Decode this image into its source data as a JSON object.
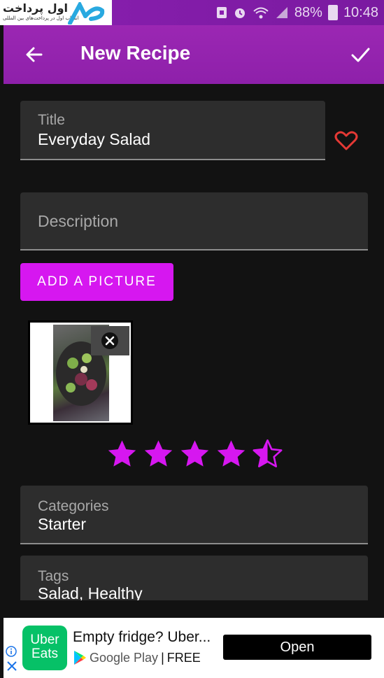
{
  "status_bar": {
    "logo_text": "اول پرداخت",
    "logo_subtext": "انتخاب اول در پرداخت‌های بین المللی",
    "battery": "88%",
    "time": "10:48"
  },
  "app_bar": {
    "title": "New Recipe",
    "back_icon": "arrow-back-icon",
    "save_icon": "check-icon"
  },
  "form": {
    "title_field": {
      "label": "Title",
      "value": "Everyday Salad"
    },
    "favorite_icon": "heart-outline-icon",
    "description_field": {
      "placeholder": "Description"
    },
    "add_picture_label": "ADD A PICTURE",
    "rating": {
      "value": 4.5,
      "max": 5
    },
    "categories_field": {
      "label": "Categories",
      "value": "Starter"
    },
    "tags_field": {
      "label": "Tags",
      "value": "Salad, Healthy"
    }
  },
  "ad": {
    "logo_line1": "Uber",
    "logo_line2": "Eats",
    "headline": "Empty fridge? Uber...",
    "store": "Google Play",
    "separator": "|",
    "price": "FREE",
    "cta": "Open"
  },
  "colors": {
    "accent": "#d617f0",
    "app_bar": "#9b27b3",
    "background": "#121212",
    "field_bg": "#2d2d2d",
    "heart": "#e53935"
  }
}
